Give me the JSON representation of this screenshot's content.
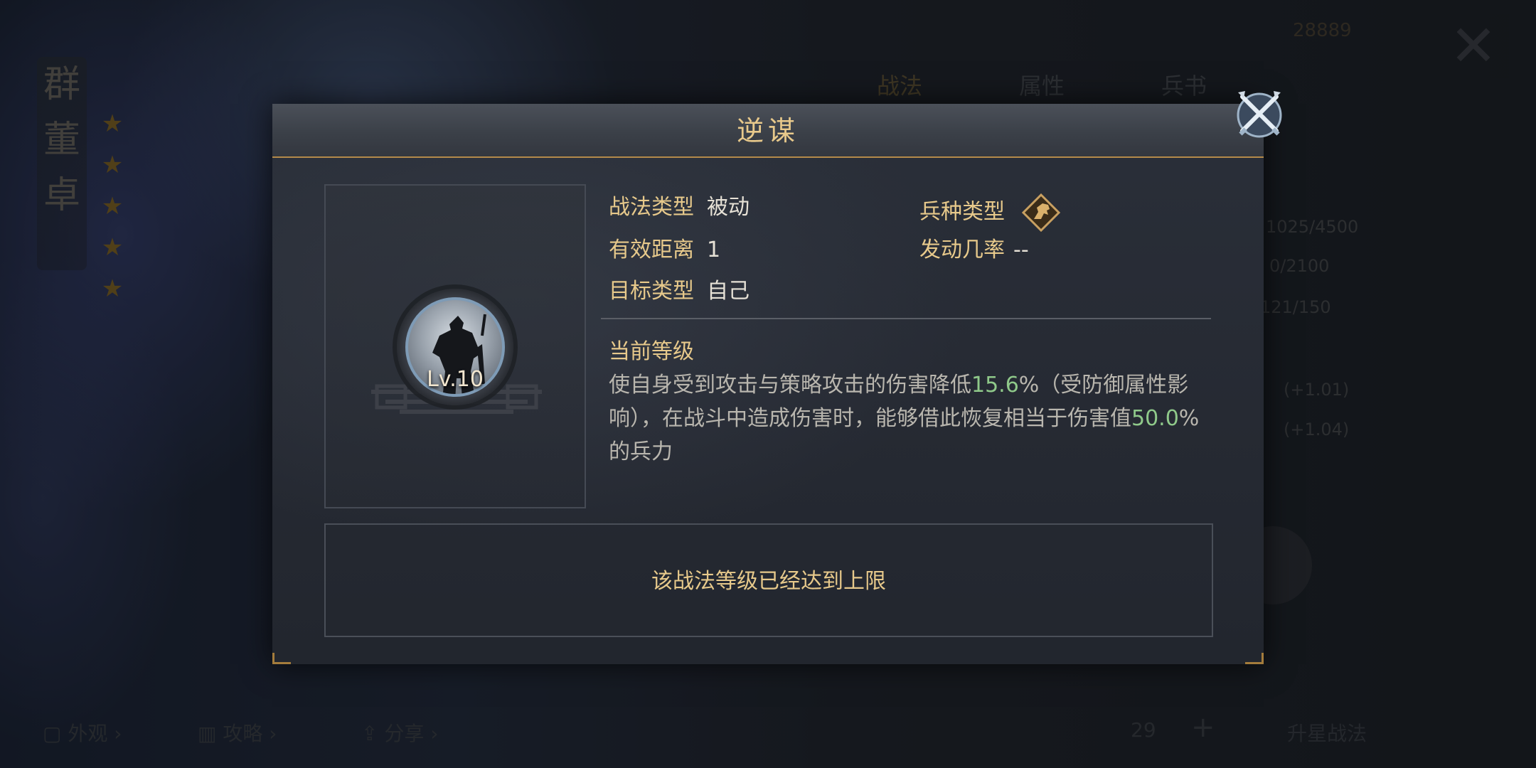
{
  "background": {
    "hero_name_chars": [
      "群",
      "董",
      "卓"
    ],
    "star_count": 5,
    "tabs": [
      "战法",
      "属性",
      "兵书"
    ],
    "active_tab": 0,
    "resource_value": "28889",
    "stats": [
      "1025/4500",
      "0/2100",
      "121/150",
      "(+1.01)",
      "(+1.04)"
    ],
    "bottom_links": [
      "外观",
      "攻略",
      "分享"
    ],
    "level_value": "29",
    "cta_label": "升星战法"
  },
  "modal": {
    "title": "逆谋",
    "skill_level": "Lv.10",
    "info": {
      "skill_type_label": "战法类型",
      "skill_type_value": "被动",
      "troop_type_label": "兵种类型",
      "range_label": "有效距离",
      "range_value": "1",
      "trigger_rate_label": "发动几率",
      "trigger_rate_value": "--",
      "target_type_label": "目标类型",
      "target_type_value": "自己"
    },
    "current_level_heading": "当前等级",
    "description": {
      "part1": "使自身受到攻击与策略攻击的伤害降低",
      "value1": "15.6",
      "part2": "%（受防御属性影响），在战斗中造成伤害时，能够借此恢复相当于伤害值",
      "value2": "50.0",
      "part3": "%的兵力"
    },
    "status_message": "该战法等级已经达到上限"
  },
  "icons": {
    "close": "crossed-swords-close-icon",
    "troop_type": "horse-cavalry-icon",
    "skill": "warrior-silhouette-icon"
  },
  "colors": {
    "gold_label": "#e7c98b",
    "highlight_value": "#8fc98a",
    "body_text": "#b9b6ae",
    "frame_gold": "#b48a4a"
  }
}
